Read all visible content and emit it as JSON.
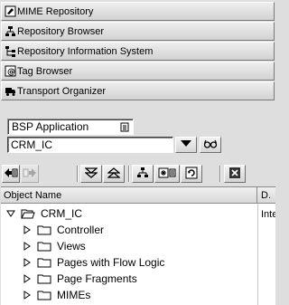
{
  "nav": {
    "items": [
      {
        "label": "MIME Repository",
        "icon": "mime-repository-icon"
      },
      {
        "label": "Repository Browser",
        "icon": "repository-browser-icon"
      },
      {
        "label": "Repository Information System",
        "icon": "information-system-icon"
      },
      {
        "label": "Tag Browser",
        "icon": "tag-browser-icon"
      },
      {
        "label": "Transport Organizer",
        "icon": "truck-icon"
      }
    ]
  },
  "object_type": {
    "selected": "BSP Application"
  },
  "object_name": {
    "value": "CRM_IC"
  },
  "table": {
    "headers": {
      "name": "Object Name",
      "desc": "D."
    },
    "root": {
      "label": "CRM_IC",
      "desc": "Inte"
    },
    "children": [
      "Controller",
      "Views",
      "Pages with Flow Logic",
      "Page Fragments",
      "MIMEs"
    ]
  }
}
